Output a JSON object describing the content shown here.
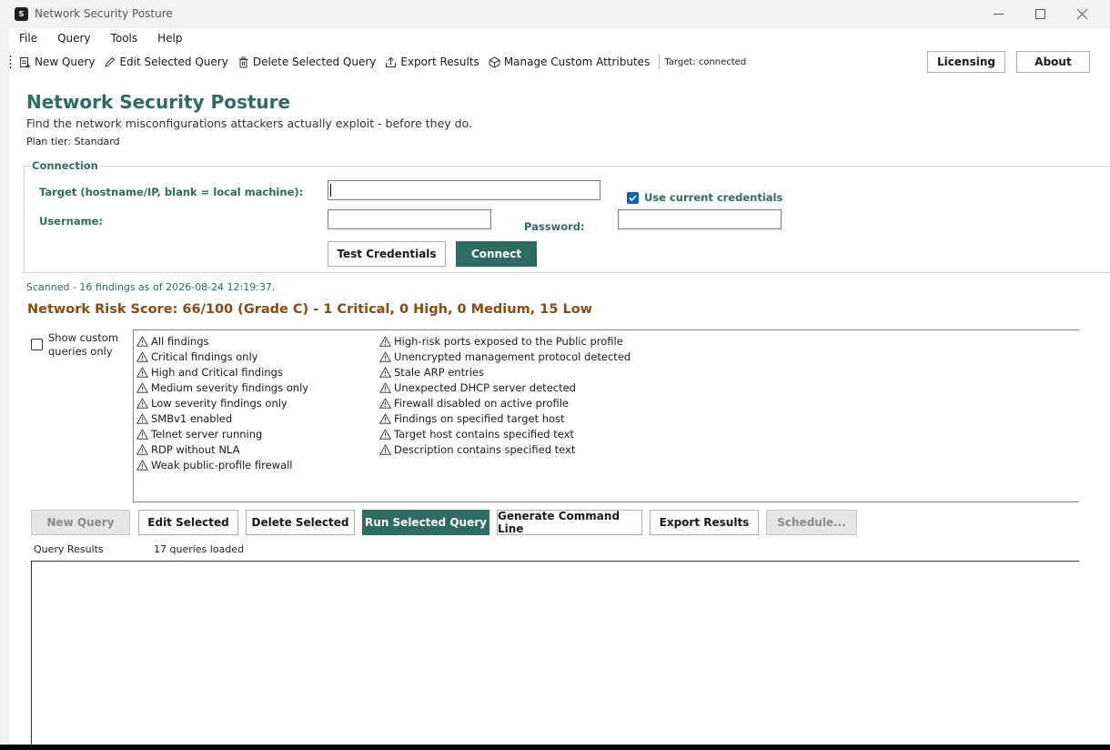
{
  "window": {
    "title": "Network Security Posture",
    "app_icon_text": "S"
  },
  "menu": [
    "File",
    "Query",
    "Tools",
    "Help"
  ],
  "toolbar": {
    "new_query": "New Query",
    "edit_selected_query": "Edit Selected Query",
    "delete_selected_query": "Delete Selected Query",
    "export_results": "Export Results",
    "manage_custom_attributes": "Manage Custom Attributes",
    "target_status": "Target: connected",
    "licensing": "Licensing",
    "about": "About"
  },
  "header": {
    "title": "Network Security Posture",
    "subtitle": "Find the network misconfigurations attackers actually exploit - before they do.",
    "plan_tier": "Plan tier: Standard"
  },
  "connection": {
    "legend": "Connection",
    "target_label": "Target (hostname/IP, blank = local machine):",
    "target_value": "",
    "use_current_credentials_label": "Use current credentials",
    "use_current_credentials_checked": true,
    "username_label": "Username:",
    "username_value": "",
    "password_label": "Password:",
    "password_value": "",
    "test_credentials": "Test Credentials",
    "connect": "Connect"
  },
  "scan": {
    "status": "Scanned - 16 findings as of 2026-08-24 12:19:37.",
    "risk_score": "Network Risk Score: 66/100 (Grade C) - 1 Critical, 0 High, 0 Medium, 15 Low"
  },
  "queries": {
    "show_custom_label": "Show custom queries only",
    "show_custom_checked": false,
    "column1": [
      "All findings",
      "Critical findings only",
      "High and Critical findings",
      "Medium severity findings only",
      "Low severity findings only",
      "SMBv1 enabled",
      "Telnet server running",
      "RDP without NLA",
      "Weak public-profile firewall"
    ],
    "column2": [
      "High-risk ports exposed to the Public profile",
      "Unencrypted management protocol detected",
      "Stale ARP entries",
      "Unexpected DHCP server detected",
      "Firewall disabled on active profile",
      "Findings on specified target host",
      "Target host contains specified text",
      "Description contains specified text"
    ]
  },
  "actions": {
    "new_query": "New Query",
    "edit_selected": "Edit Selected",
    "delete_selected": "Delete Selected",
    "run_selected_query": "Run Selected Query",
    "generate_command_line": "Generate Command Line",
    "export_results": "Export Results",
    "schedule": "Schedule..."
  },
  "results": {
    "label": "Query Results",
    "count": "17 queries loaded"
  },
  "colors": {
    "accent": "#2e6b62",
    "risk": "#8a4b0f",
    "checkbox": "#0f62b8"
  }
}
